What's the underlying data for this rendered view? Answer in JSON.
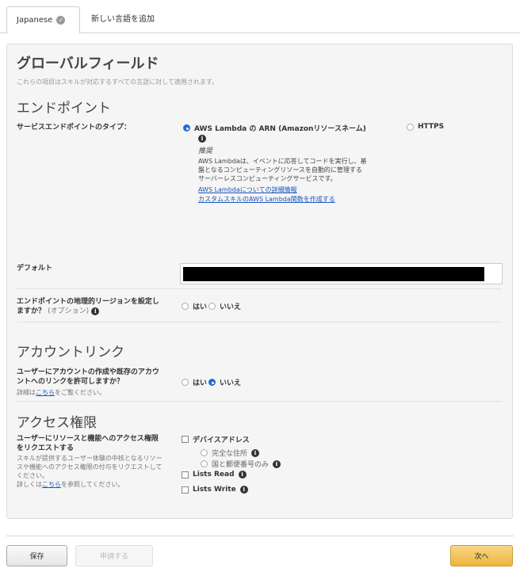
{
  "tabs": {
    "active_label": "Japanese",
    "add_label": "新しい言語を追加"
  },
  "global": {
    "title": "グローバルフィールド",
    "subtitle": "これらの項目はスキルが対応するすべての言語に対して適用されます。"
  },
  "endpoint": {
    "heading": "エンドポイント",
    "type_label": "サービスエンドポイントのタイプ：",
    "lambda_option": "AWS Lambda の ARN (Amazonリソースネーム)",
    "https_option": "HTTPS",
    "recommended": "推奨",
    "desc_line1": "AWS Lambdaは、イベントに応答してコードを実行し、基",
    "desc_line2": "盤となるコンピューティングリソースを自動的に管理する",
    "desc_line3": "サーバーレスコンピューティングサービスです。",
    "link_details": "AWS Lambdaについての詳細情報",
    "link_create": "カスタムスキルのAWS Lambda関数を作成する",
    "default_label": "デフォルト",
    "region_label_line1": "エンドポイントの地理的リージョンを設定し",
    "region_label_line2": "ますか？",
    "region_optional": "(オプション)",
    "yes": "はい",
    "no": "いいえ"
  },
  "account_linking": {
    "heading": "アカウントリンク",
    "question_line1": "ユーザーにアカウントの作成や既存のアカウ",
    "question_line2": "ントへのリンクを許可しますか？",
    "details_prefix": "詳細は",
    "details_link": "こちら",
    "details_suffix": "をご覧ください。",
    "yes": "はい",
    "no": "いいえ"
  },
  "permissions": {
    "heading": "アクセス権限",
    "question_line1": "ユーザーにリソースと機能へのアクセス権限",
    "question_line2": "をリクエストする",
    "desc_line1": "スキルが提供するユーザー体験の中核となるリソー",
    "desc_line2": "スや機能へのアクセス権限の付与をリクエストして",
    "desc_line3": "ください。",
    "ref_prefix": "詳しくは",
    "ref_link": "こちら",
    "ref_suffix": "を参照してください。",
    "device_address": "デバイスアドレス",
    "full_address": "完全な住所",
    "country_postal": "国と郵便番号のみ",
    "lists_read": "Lists Read",
    "lists_write": "Lists Write"
  },
  "footer": {
    "save": "保存",
    "request": "申請する",
    "next": "次へ"
  },
  "colors": {
    "accent": "#1f6fd1",
    "next_button": "#efb43a",
    "link": "#1a56b8"
  }
}
